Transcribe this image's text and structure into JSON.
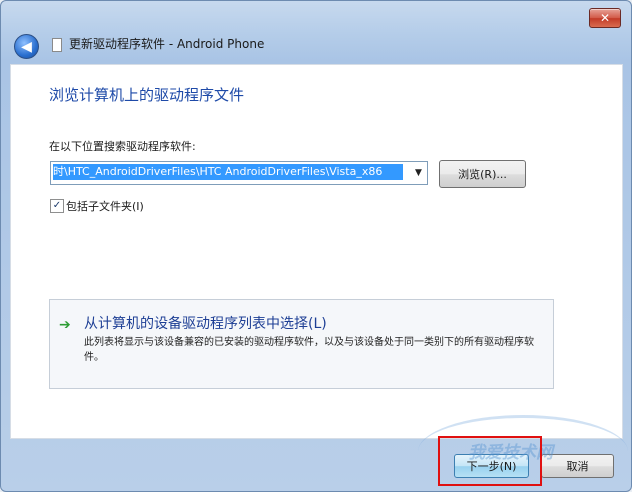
{
  "window": {
    "title": "更新驱动程序软件 - Android Phone",
    "close_label": "✕",
    "back_label": "◀"
  },
  "page": {
    "heading": "浏览计算机上的驱动程序文件",
    "search_label": "在以下位置搜索驱动程序软件:",
    "path_value": "时\\HTC_AndroidDriverFiles\\HTC AndroidDriverFiles\\Vista_x86",
    "dropdown_glyph": "▼",
    "browse_label": "浏览(R)...",
    "include_subfolders_label": "包括子文件夹(I)",
    "include_subfolders_checked": true,
    "check_glyph": "✓"
  },
  "option": {
    "arrow_glyph": "➔",
    "title": "从计算机的设备驱动程序列表中选择(L)",
    "description": "此列表将显示与该设备兼容的已安装的驱动程序软件，以及与该设备处于同一类别下的所有驱动程序软件。"
  },
  "footer": {
    "next_label": "下一步(N)",
    "cancel_label": "取消"
  },
  "watermark": {
    "text": "我爱技术网"
  },
  "colors": {
    "accent": "#1e4aa8",
    "highlight": "#e01010",
    "selection": "#3399ff"
  }
}
